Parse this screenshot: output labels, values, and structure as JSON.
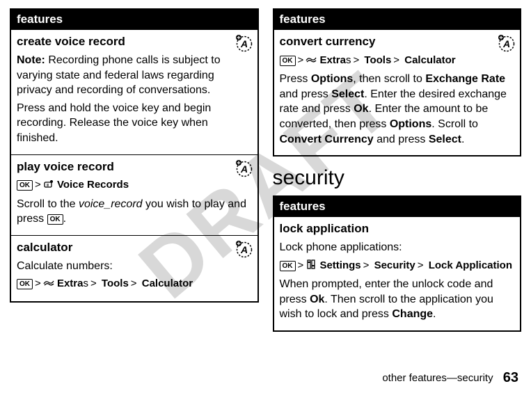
{
  "watermark": "DRAFT",
  "left": {
    "header": "features",
    "rows": [
      {
        "title": "create voice record",
        "badge": true,
        "paras": [
          {
            "html": "<span class='note-label'>Note:</span> Recording phone calls is subject to varying state and federal laws regarding privacy and recording of conversations."
          },
          {
            "text": "Press and hold the voice key and begin recording. Release the voice key when finished."
          }
        ]
      },
      {
        "title": "play voice record",
        "badge": true,
        "paras": [
          {
            "path": [
              {
                "k": "ok"
              },
              {
                "k": "gt"
              },
              {
                "k": "icon",
                "name": "record-icon"
              },
              {
                "b": "Voice Records"
              }
            ]
          },
          {
            "html": "Scroll to the <span class='italic'>voice_record</span> you wish to play and press <span class='navkey'>OK</span>."
          }
        ]
      },
      {
        "title": "calculator",
        "badge": true,
        "paras": [
          {
            "text": "Calculate numbers:"
          },
          {
            "path": [
              {
                "k": "ok"
              },
              {
                "k": "gt"
              },
              {
                "k": "icon",
                "name": "extras-icon"
              },
              {
                "b": "Extra"
              },
              {
                "t": "s"
              },
              {
                "k": "gt"
              },
              {
                "b": "Tools"
              },
              {
                "k": "gt"
              },
              {
                "b": "Calculator"
              }
            ]
          }
        ]
      }
    ]
  },
  "right": {
    "header": "features",
    "rows": [
      {
        "title": "convert currency",
        "badge": true,
        "paras": [
          {
            "path": [
              {
                "k": "ok"
              },
              {
                "k": "gt"
              },
              {
                "k": "icon",
                "name": "extras-icon"
              },
              {
                "b": "Extra"
              },
              {
                "t": "s"
              },
              {
                "k": "gt"
              },
              {
                "b": "Tools"
              },
              {
                "k": "gt"
              },
              {
                "b": "Calculator"
              }
            ]
          },
          {
            "html": "Press <span class='condensed'>Options</span>, then scroll to <span class='condensed'>Exchange Rate</span> and press <span class='condensed'>Select</span>. Enter the desired exchange rate and press <span class='condensed'>Ok</span>. Enter the amount to be converted, then press <span class='condensed'>Options</span>. Scroll to <span class='condensed'>Convert Currency</span> and press <span class='condensed'>Select</span>."
          }
        ]
      }
    ]
  },
  "section_heading": "security",
  "security": {
    "header": "features",
    "rows": [
      {
        "title": "lock application",
        "badge": false,
        "paras": [
          {
            "text": "Lock phone applications:"
          },
          {
            "path": [
              {
                "k": "ok"
              },
              {
                "k": "gt"
              },
              {
                "k": "icon",
                "name": "settings-icon"
              },
              {
                "b": "Settings"
              },
              {
                "k": "gt"
              },
              {
                "b": "Security"
              },
              {
                "k": "gt"
              },
              {
                "b": "Lock Application"
              }
            ]
          },
          {
            "html": "When prompted, enter the unlock code and press <span class='condensed'>Ok</span>. Then scroll to the application you wish to lock and press <span class='condensed'>Change</span>."
          }
        ]
      }
    ]
  },
  "footer": {
    "text": "other features—security",
    "page": "63"
  }
}
